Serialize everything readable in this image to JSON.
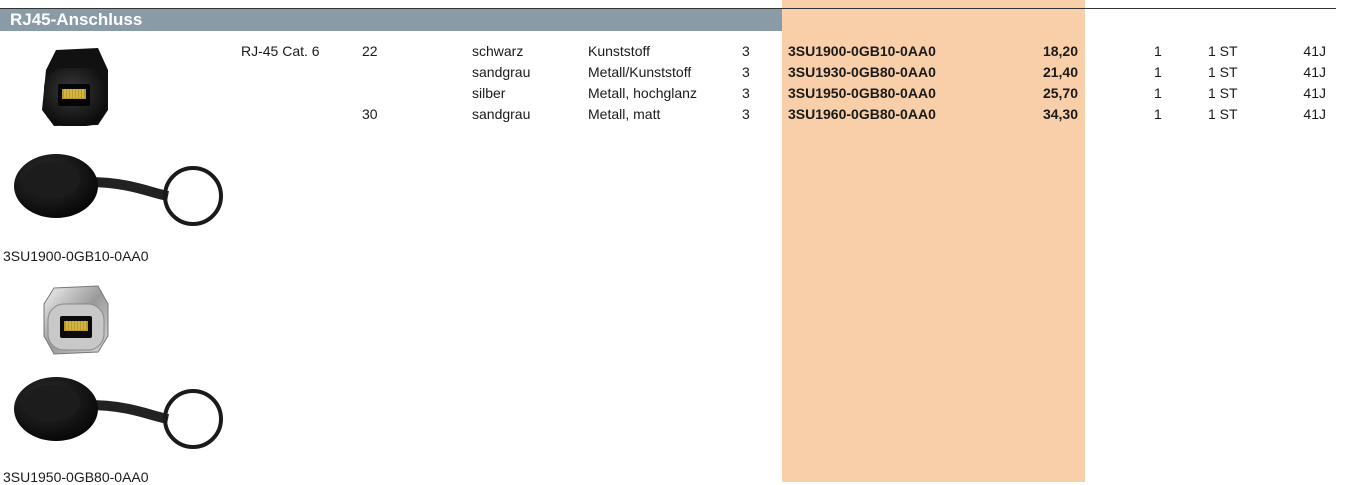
{
  "section": {
    "title": "RJ45-Anschluss"
  },
  "rows": [
    {
      "type": "RJ-45 Cat. 6",
      "size": "22",
      "color": "schwarz",
      "material": "Kunststoff",
      "qty": "3",
      "article": "3SU1900-0GB10-0AA0",
      "price": "18,20",
      "pu": "1",
      "unit": "1 ST",
      "pg": "41J"
    },
    {
      "type": "",
      "size": "",
      "color": "sandgrau",
      "material": "Metall/Kunststoff",
      "qty": "3",
      "article": "3SU1930-0GB80-0AA0",
      "price": "21,40",
      "pu": "1",
      "unit": "1 ST",
      "pg": "41J"
    },
    {
      "type": "",
      "size": "",
      "color": "silber",
      "material": "Metall, hochglanz",
      "qty": "3",
      "article": "3SU1950-0GB80-0AA0",
      "price": "25,70",
      "pu": "1",
      "unit": "1 ST",
      "pg": "41J"
    },
    {
      "type": "",
      "size": "30",
      "color": "sandgrau",
      "material": "Metall, matt",
      "qty": "3",
      "article": "3SU1960-0GB80-0AA0",
      "price": "34,30",
      "pu": "1",
      "unit": "1 ST",
      "pg": "41J"
    }
  ],
  "captions": [
    "3SU1900-0GB10-0AA0",
    "3SU1950-0GB80-0AA0"
  ],
  "colors": {
    "header_bg": "#8a9ba8",
    "highlight_column": "#f8cfa9"
  }
}
